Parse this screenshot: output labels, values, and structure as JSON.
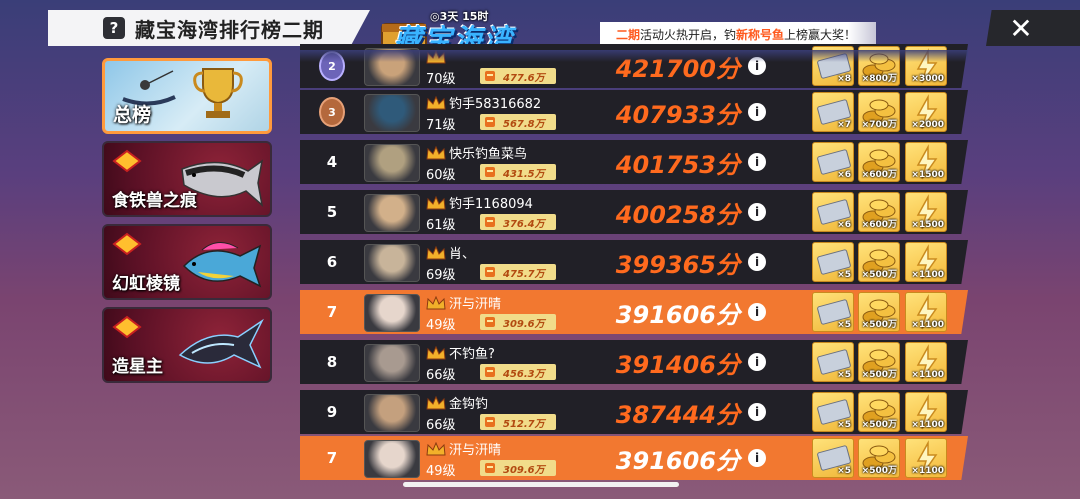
{
  "header": {
    "title": "藏宝海湾排行榜二期",
    "help": "?",
    "logo_timer": "◎3天 15时",
    "logo_text": "藏宝海湾",
    "banner": {
      "p1": "二期",
      "p2": "活动火热开启，钓",
      "p3": "新称号鱼",
      "p4": "上榜赢大奖！"
    },
    "close": "✕"
  },
  "sidebar": [
    {
      "label": "总榜",
      "active": true
    },
    {
      "label": "食铁兽之痕",
      "active": false
    },
    {
      "label": "幻虹棱镜",
      "active": false
    },
    {
      "label": "造星主",
      "active": false
    }
  ],
  "rows": [
    {
      "rank": "2",
      "medal": "silver",
      "name": "",
      "level": "70级",
      "power": "477.6万",
      "score": "421700分",
      "me": false,
      "rewards": [
        "×8",
        "×800万",
        "×3000"
      ]
    },
    {
      "rank": "3",
      "medal": "bronze",
      "name": "钓手58316682",
      "level": "71级",
      "power": "567.8万",
      "score": "407933分",
      "me": false,
      "rewards": [
        "×7",
        "×700万",
        "×2000"
      ]
    },
    {
      "rank": "4",
      "medal": "",
      "name": "快乐钓鱼菜鸟",
      "level": "60级",
      "power": "431.5万",
      "score": "401753分",
      "me": false,
      "rewards": [
        "×6",
        "×600万",
        "×1500"
      ]
    },
    {
      "rank": "5",
      "medal": "",
      "name": "钓手1168094",
      "level": "61级",
      "power": "376.4万",
      "score": "400258分",
      "me": false,
      "rewards": [
        "×6",
        "×600万",
        "×1500"
      ]
    },
    {
      "rank": "6",
      "medal": "",
      "name": "肖、",
      "level": "69级",
      "power": "475.7万",
      "score": "399365分",
      "me": false,
      "rewards": [
        "×5",
        "×500万",
        "×1100"
      ]
    },
    {
      "rank": "7",
      "medal": "",
      "name": "汧与汧晴",
      "level": "49级",
      "power": "309.6万",
      "score": "391606分",
      "me": true,
      "rewards": [
        "×5",
        "×500万",
        "×1100"
      ]
    },
    {
      "rank": "8",
      "medal": "",
      "name": "不钓鱼?",
      "level": "66级",
      "power": "456.3万",
      "score": "391406分",
      "me": false,
      "rewards": [
        "×5",
        "×500万",
        "×1100"
      ]
    },
    {
      "rank": "9",
      "medal": "",
      "name": "金钩钓",
      "level": "66级",
      "power": "512.7万",
      "score": "387444分",
      "me": false,
      "rewards": [
        "×5",
        "×500万",
        "×1100"
      ]
    },
    {
      "rank": "7",
      "medal": "",
      "name": "汧与汧晴",
      "level": "49级",
      "power": "309.6万",
      "score": "391606分",
      "me": true,
      "rewards": [
        "×5",
        "×500万",
        "×1100"
      ]
    }
  ],
  "info_glyph": "i",
  "colors": {
    "accent_orange": "#f27830",
    "score_orange": "#ff6a1e",
    "row_dark": "#212027",
    "gold": "#f4b93a"
  }
}
